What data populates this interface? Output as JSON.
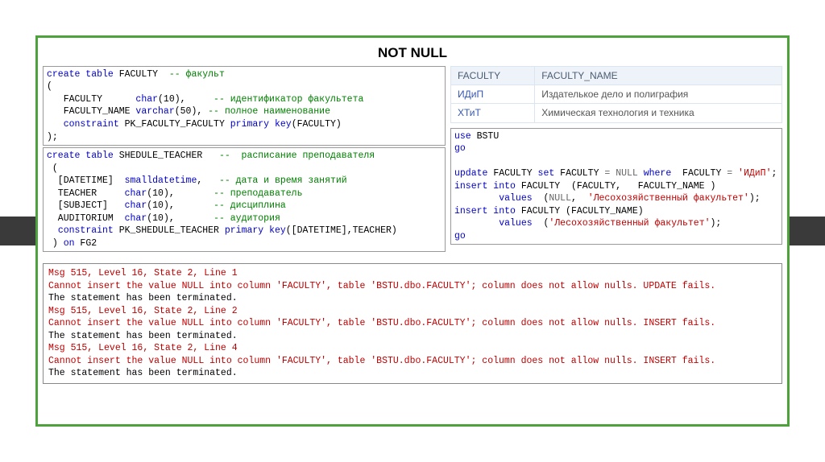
{
  "title": "NOT NULL",
  "code1": {
    "l1a": "create table",
    "l1b": " FACULTY  ",
    "l1c": "-- факульт",
    "l2": "(",
    "l3a": "   FACULTY      ",
    "l3b": "char",
    "l3c": "(10),     ",
    "l3d": "-- идентификатор факультета",
    "l4a": "   FACULTY_NAME ",
    "l4b": "varchar",
    "l4c": "(50), ",
    "l4d": "-- полное наименование",
    "l5a": "   ",
    "l5b": "constraint",
    "l5c": " PK_FACULTY_FACULTY ",
    "l5d": "primary key",
    "l5e": "(FACULTY)",
    "l6": ");"
  },
  "code2": {
    "l1a": "create table",
    "l1b": " SHEDULE_TEACHER   ",
    "l1c": "--  расписание преподавателя",
    "l2": " (",
    "l3a": "  [DATETIME]  ",
    "l3b": "smalldatetime",
    "l3c": ",   ",
    "l3d": "-- дата и время занятий",
    "l4a": "  TEACHER     ",
    "l4b": "char",
    "l4c": "(10),       ",
    "l4d": "-- преподаватель",
    "l5a": "  [SUBJECT]   ",
    "l5b": "char",
    "l5c": "(10),       ",
    "l5d": "-- дисциплина",
    "l6a": "  AUDITORIUM  ",
    "l6b": "char",
    "l6c": "(10),       ",
    "l6d": "-- аудитория",
    "l7a": "  ",
    "l7b": "constraint",
    "l7c": " PK_SHEDULE_TEACHER ",
    "l7d": "primary key",
    "l7e": "([DATETIME],TEACHER)",
    "l8a": " ) ",
    "l8b": "on",
    "l8c": " FG2"
  },
  "table": {
    "h1": "FACULTY",
    "h2": "FACULTY_NAME",
    "r1c1": "ИДиП",
    "r1c2": "Издателькое дело и полиграфия",
    "r2c1": "ХТиТ",
    "r2c2": "Химическая технология и техника"
  },
  "code3": {
    "l1a": "use",
    "l1b": " BSTU",
    "l2": "go",
    "blank": " ",
    "l3a": "update",
    "l3b": " FACULTY ",
    "l3c": "set",
    "l3d": " FACULTY ",
    "l3e": "=",
    "l3f": " NULL ",
    "l3g": "where",
    "l3h": "  FACULTY ",
    "l3i": "=",
    "l3j": " 'ИДиП'",
    "l3k": ";",
    "l4a": "insert into",
    "l4b": " FACULTY  ",
    "l4c": "(FACULTY,   FACULTY_NAME )",
    "l5a": "        ",
    "l5b": "values",
    "l5c": "  (",
    "l5d": "NULL",
    "l5e": ",  ",
    "l5f": "'Лесохозяйственный факультет'",
    "l5g": ");",
    "l6a": "insert into",
    "l6b": " FACULTY ",
    "l6c": "(FACULTY_NAME)",
    "l7a": "        ",
    "l7b": "values",
    "l7c": "  (",
    "l7d": "'Лесохозяйственный факультет'",
    "l7e": ");",
    "l8": "go"
  },
  "errors": {
    "m1": "Msg 515, Level 16, State 2, Line 1",
    "e1": "Cannot insert the value NULL into column 'FACULTY', table 'BSTU.dbo.FACULTY'; column does not allow nulls. UPDATE fails.",
    "t1": "The statement has been terminated.",
    "m2": "Msg 515, Level 16, State 2, Line 2",
    "e2": "Cannot insert the value NULL into column 'FACULTY', table 'BSTU.dbo.FACULTY'; column does not allow nulls. INSERT fails.",
    "t2": "The statement has been terminated.",
    "m3": "Msg 515, Level 16, State 2, Line 4",
    "e3": "Cannot insert the value NULL into column 'FACULTY', table 'BSTU.dbo.FACULTY'; column does not allow nulls. INSERT fails.",
    "t3": "The statement has been terminated."
  }
}
